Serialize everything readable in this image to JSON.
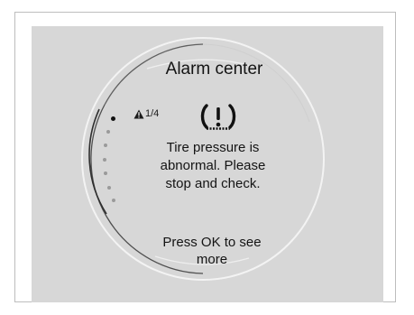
{
  "alarm_center": {
    "title": "Alarm center",
    "counter": "1/4",
    "icon": "tire-pressure-warning-icon",
    "message": "Tire pressure is\nabnormal. Please\nstop and check.",
    "footer": "Press OK to see\nmore",
    "page_indicator": {
      "total": 7,
      "active": 7
    }
  },
  "colors": {
    "screen_background": "#d7d7d7",
    "text": "#141414",
    "indicator_inactive": "#9a9a9a",
    "indicator_active": "#111111"
  }
}
